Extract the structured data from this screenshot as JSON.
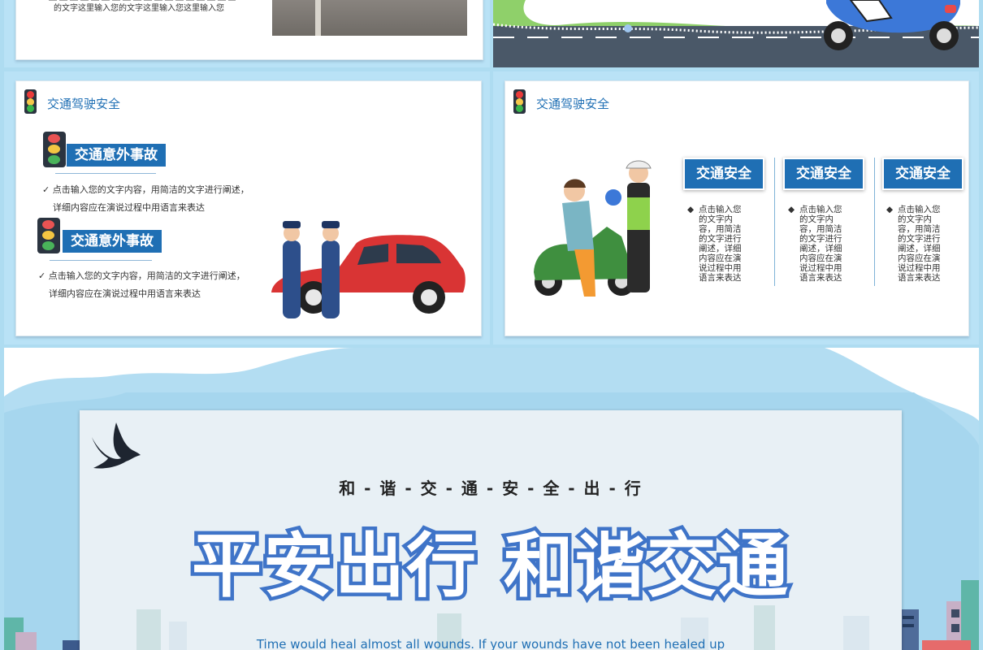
{
  "slide_top_left": {
    "text_line2": "的文字这里输入您的文字这里输入您这里输入您"
  },
  "slide_mid_left": {
    "header": "交通驾驶安全",
    "sections": [
      {
        "title": "交通意外事故",
        "line1": "点击输入您的文字内容，用简洁的文字进行阐述，",
        "line2": "详细内容应在演说过程中用语言来表达"
      },
      {
        "title": "交通意外事故",
        "line1": "点击输入您的文字内容，用简洁的文字进行阐述，",
        "line2": "详细内容应在演说过程中用语言来表达"
      }
    ]
  },
  "slide_mid_right": {
    "header": "交通驾驶安全",
    "columns": [
      {
        "title": "交通安全",
        "text": "点击输入您的文字内容，用简洁的文字进行阐述，详细内容应在演说过程中用语言来表达"
      },
      {
        "title": "交通安全",
        "text": "点击输入您的文字内容，用简洁的文字进行阐述，详细内容应在演说过程中用语言来表达"
      },
      {
        "title": "交通安全",
        "text": "点击输入您的文字内容，用简洁的文字进行阐述，详细内容应在演说过程中用语言来表达"
      }
    ]
  },
  "slide_bottom": {
    "subtitle": "和 - 谐 - 交 - 通 - 安 - 全 - 出 - 行",
    "title": "平安出行 和谐交通",
    "tagline": "Time would heal almost all wounds. If your wounds have not been healed up"
  },
  "colors": {
    "accent": "#1f6fb4",
    "title_fill": "#ffffff",
    "title_outline": "#3f74c8",
    "background": "#aedcf1"
  }
}
